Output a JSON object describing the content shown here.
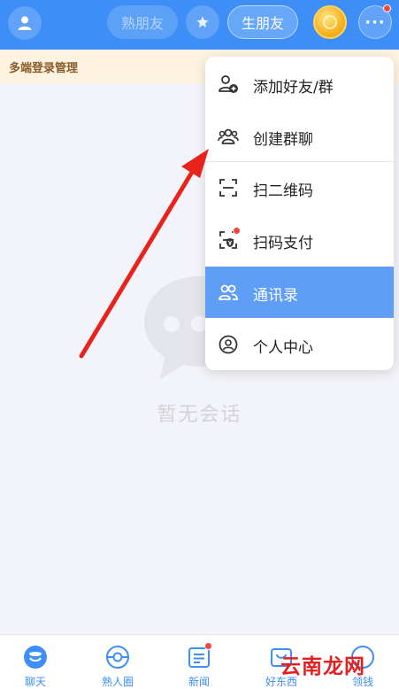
{
  "header": {
    "tabs": [
      {
        "label": "熟朋友",
        "selected": false
      },
      {
        "label": "生朋友",
        "selected": true
      }
    ],
    "icons": {
      "avatar": "person-icon",
      "favorite": "star-icon",
      "coin": "coin-icon",
      "more": "more-dots-icon"
    },
    "more_has_badge": true
  },
  "banner": {
    "text": "多端登录管理"
  },
  "empty_state": {
    "text": "暂无会话",
    "icon": "chat-bubble-icon"
  },
  "menu": {
    "items": [
      {
        "label": "添加好友/群",
        "icon": "add-friend-icon",
        "active": false
      },
      {
        "label": "创建群聊",
        "icon": "group-chat-icon",
        "active": false
      },
      {
        "label": "扫二维码",
        "icon": "scan-icon",
        "active": false
      },
      {
        "label": "扫码支付",
        "icon": "scan-pay-icon",
        "active": false,
        "badge": true
      },
      {
        "label": "通讯录",
        "icon": "contacts-icon",
        "active": true
      },
      {
        "label": "个人中心",
        "icon": "profile-icon",
        "active": false
      }
    ]
  },
  "bottom_nav": {
    "items": [
      {
        "label": "聊天",
        "icon": "chat-icon",
        "selected": true
      },
      {
        "label": "熟人圈",
        "icon": "circle-icon",
        "selected": false
      },
      {
        "label": "新闻",
        "icon": "news-icon",
        "selected": false,
        "badge": true
      },
      {
        "label": "好东西",
        "icon": "goods-icon",
        "selected": false
      },
      {
        "label": "领钱",
        "icon": "money-icon",
        "selected": false
      }
    ]
  },
  "watermark": {
    "text": "云南龙网"
  },
  "colors": {
    "header": "#3d8ff7",
    "banner_bg": "#fdf3e0",
    "banner_text": "#8a5a2a",
    "menu_active": "#5f9ef7",
    "badge": "#f3463f",
    "annotation_arrow": "#e8231e"
  }
}
